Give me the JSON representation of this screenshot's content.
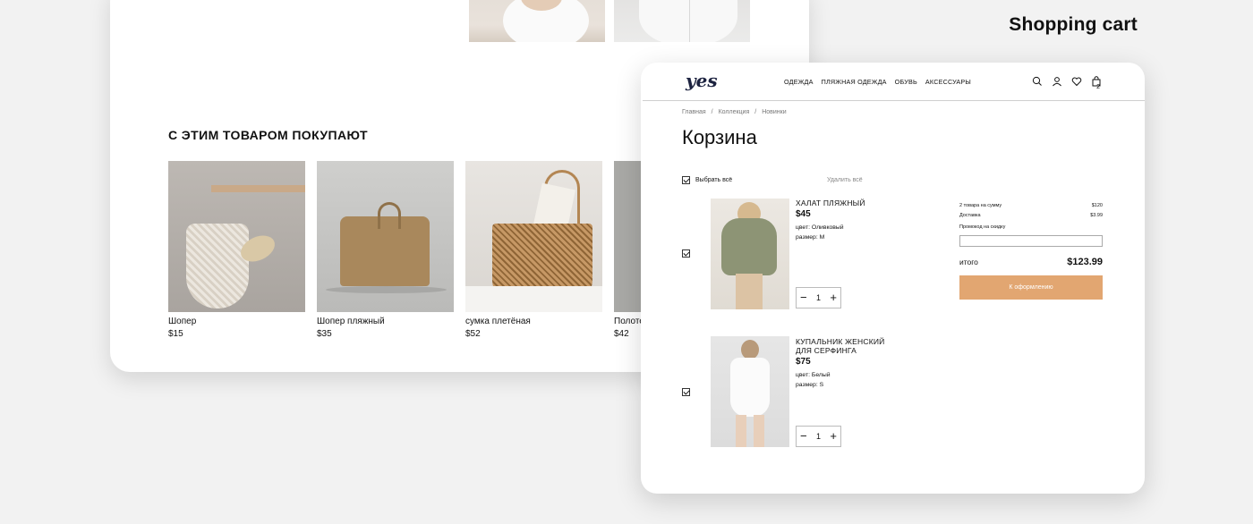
{
  "header": {
    "title": "Shopping cart"
  },
  "recommendations": {
    "title": "С ЭТИМ ТОВАРОМ ПОКУПАЮТ",
    "items": [
      {
        "name": "Шопер",
        "price": "$15"
      },
      {
        "name": "Шопер пляжный",
        "price": "$35"
      },
      {
        "name": "сумка плетёная",
        "price": "$52"
      },
      {
        "name": "Полотенце",
        "price": "$42"
      }
    ]
  },
  "store": {
    "logo": "yes",
    "nav": [
      "ОДЕЖДА",
      "ПЛЯЖНАЯ ОДЕЖДА",
      "ОБУВЬ",
      "АКСЕССУАРЫ"
    ],
    "icons": [
      "search-icon",
      "user-icon",
      "heart-icon",
      "bag-icon"
    ],
    "cart_count": "2"
  },
  "breadcrumbs": [
    "Главная",
    "/",
    "Коллекция",
    "/",
    "Новинки"
  ],
  "cart": {
    "title": "Корзина",
    "select_all": "Выбрать всё",
    "delete_all": "Удалить всё",
    "items": [
      {
        "name": "ХАЛАТ ПЛЯЖНЫЙ",
        "price": "$45",
        "color": "цвет: Оливковый",
        "size": "размер: M",
        "qty": "1"
      },
      {
        "name": "КУПАЛЬНИК ЖЕНСКИЙ ДЛЯ СЕРФИНГА",
        "price": "$75",
        "color": "цвет: Белый",
        "size": "размер: S",
        "qty": "1"
      }
    ],
    "summary": {
      "items_label": "2 товара на сумму",
      "items_value": "$120",
      "delivery_label": "Доставка",
      "delivery_value": "$3.99",
      "promo_label": "Промокод на скидку",
      "promo_value": "",
      "total_label": "итого",
      "total_value": "$123.99",
      "checkout_label": "К оформлению"
    },
    "stepper": {
      "minus": "−",
      "plus": "+"
    }
  },
  "colors": {
    "accent": "#e2a671",
    "logo": "#1d2340",
    "background": "#f2f2f2"
  }
}
